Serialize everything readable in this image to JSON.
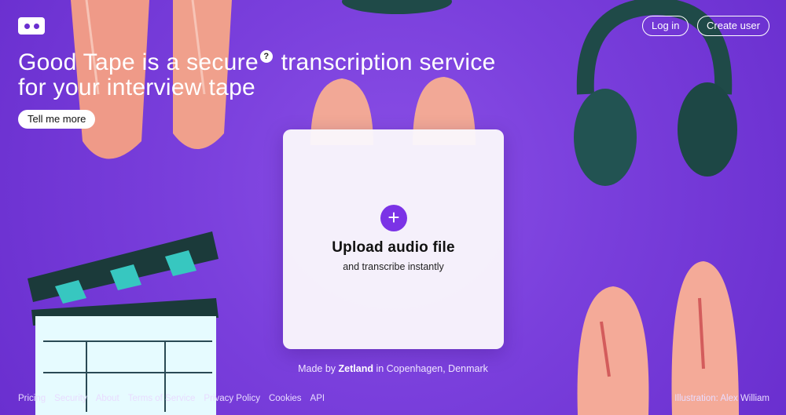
{
  "header": {
    "login_label": "Log in",
    "create_user_label": "Create user"
  },
  "hero": {
    "headline_part1": "Good Tape is a secure",
    "headline_qmark": "?",
    "headline_part2": " transcription service for your interview tape",
    "cta_label": "Tell me more"
  },
  "upload": {
    "title": "Upload audio file",
    "subtitle": "and transcribe instantly",
    "icon": "plus-icon"
  },
  "madeby": {
    "prefix": "Made by ",
    "brand": "Zetland",
    "suffix": " in Copenhagen, Denmark"
  },
  "footer": {
    "links": [
      "Pricing",
      "Security",
      "About",
      "Terms of Service",
      "Privacy Policy",
      "Cookies",
      "API"
    ],
    "credit": "Illustration: Alex William"
  },
  "colors": {
    "background": "#7a3fdc",
    "accent": "#7b33e6",
    "card": "#faf7fc"
  }
}
